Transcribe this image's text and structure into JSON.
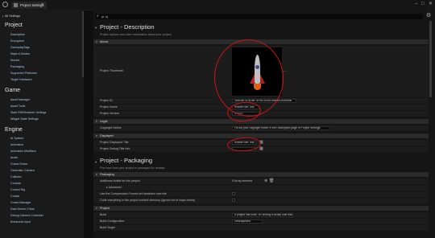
{
  "window": {
    "tab_label": "Project Settings",
    "close_glyph": "✕",
    "minimize_glyph": "–",
    "maximize_glyph": "□"
  },
  "sidebar": {
    "all_settings": "All Settings",
    "sections": [
      {
        "title": "Project",
        "items": [
          "Description",
          "Encryption",
          "GameplayTags",
          "Maps & Modes",
          "Movies",
          "Packaging",
          "Supported Platforms",
          "Target Hardware"
        ]
      },
      {
        "title": "Game",
        "items": [
          "Asset Manager",
          "Asset Tools",
          "Slate RHIRenderer Settings",
          "Widget State Settings"
        ]
      },
      {
        "title": "Engine",
        "items": [
          "AI System",
          "Animation",
          "Animation Modifiers",
          "Audio",
          "Chaos Solver",
          "Cinematic Camera",
          "Collision",
          "Console",
          "Control Rig",
          "Cooker",
          "Crowd Manager",
          "Data Driven CVars",
          "Debug Camera Controller",
          "Enhanced Input"
        ]
      }
    ]
  },
  "search": {
    "value": "pr oj"
  },
  "description": {
    "title": "Project - Description",
    "subtitle": "Project options and other information about your project.",
    "about_label": "About",
    "thumbnail_label": "Project Thumbnail",
    "project_id_label": "Project ID",
    "project_id_value": "2A5D5E75-4DBF-4F5A-9D04-D88B0D4A5E6B",
    "project_name_label": "Project Name",
    "project_name_value": "Rocket Sim Tool",
    "project_version_label": "Project Version",
    "project_version_value": "1.0.0.0",
    "legal_label": "Legal",
    "copyright_label": "Copyright Notice",
    "copyright_value": "Fill out your copyright notice in the Description page of Project Settings.",
    "displayed_label": "Displayed",
    "displayed_title_label": "Project Displayed Title",
    "displayed_title_value": "Rocket Sim Tool",
    "debug_title_label": "Project Debug Title Info",
    "debug_title_value": ""
  },
  "packaging": {
    "title": "Project - Packaging",
    "subtitle": "Fine tune how your project is packaged for release.",
    "packaging_label": "Packaging",
    "additional_builds_label": "Additional builds for this project",
    "additional_builds_value": "0 Array element",
    "advanced_label": "Advanced",
    "compression_label": "Use the Compression Format set hardware override",
    "code_everything_label": "Code everything in the project content directory (ignore list of maps below)",
    "project_label": "Project",
    "build_label": "Build",
    "build_value": "If project has code, or running a locally built editor",
    "build_config_label": "Build Configuration",
    "build_config_value": "Development",
    "build_target_label": "Build Target"
  },
  "icons": {
    "search": "search-icon",
    "gear": "gear-icon",
    "add": "plus-circle-icon",
    "delete": "trash-icon",
    "text_tool": "text-tool-icon"
  },
  "colors": {
    "annotation": "#cc1414",
    "accent_link": "#a8c8e8"
  }
}
